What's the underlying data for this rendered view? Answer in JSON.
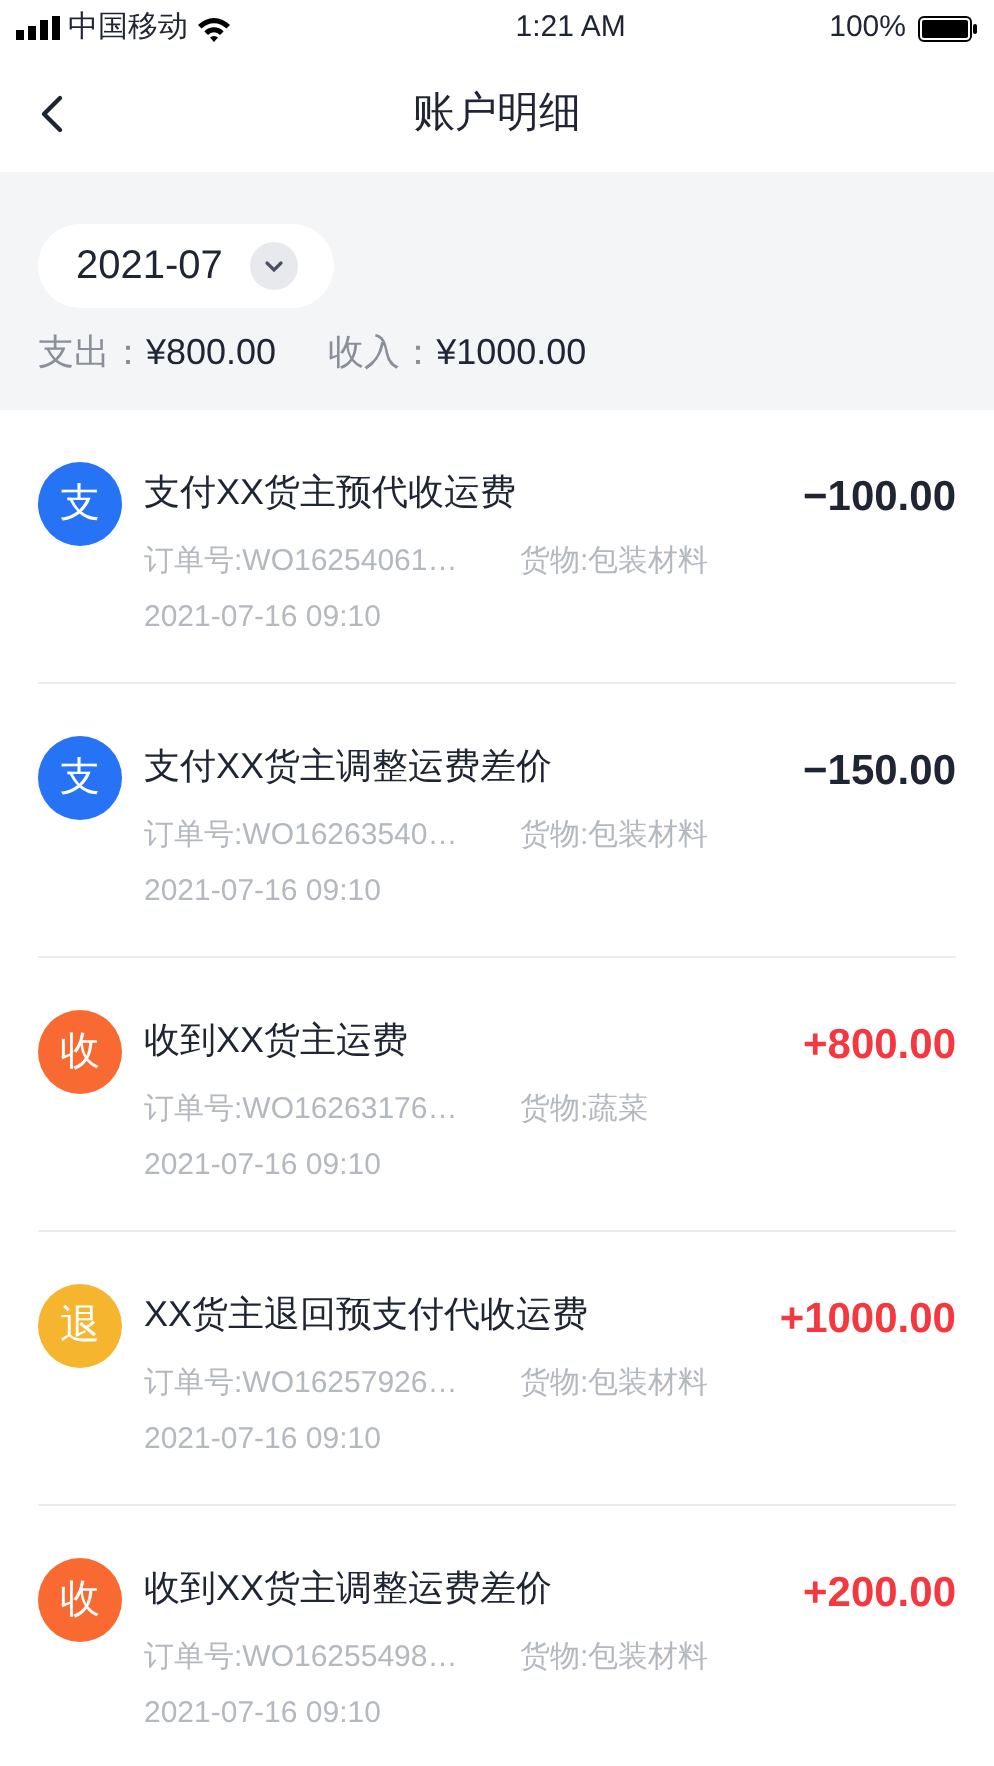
{
  "status_bar": {
    "carrier": "中国移动",
    "time": "1:21 AM",
    "battery": "100%"
  },
  "header": {
    "title": "账户明细"
  },
  "filter": {
    "month": "2021-07"
  },
  "summary": [
    {
      "label": "支出：",
      "value": "¥800.00"
    },
    {
      "label": "收入：",
      "value": "¥1000.00"
    }
  ],
  "transactions": [
    {
      "badge": "支",
      "color": "#2673f5",
      "kind": "expense",
      "title": "支付XX货主预代收运费",
      "amount": "−100.00",
      "order": "订单号:WO16254061…",
      "goods": "货物:包装材料",
      "time": "2021-07-16 09:10"
    },
    {
      "badge": "支",
      "color": "#2673f5",
      "kind": "expense",
      "title": "支付XX货主调整运费差价",
      "amount": "−150.00",
      "order": "订单号:WO16263540…",
      "goods": "货物:包装材料",
      "time": "2021-07-16 09:10"
    },
    {
      "badge": "收",
      "color": "#f86a32",
      "kind": "income",
      "title": "收到XX货主运费",
      "amount": "+800.00",
      "order": "订单号:WO16263176…",
      "goods": "货物:蔬菜",
      "time": "2021-07-16 09:10"
    },
    {
      "badge": "退",
      "color": "#f6b52e",
      "kind": "income",
      "title": "XX货主退回预支付代收运费",
      "amount": "+1000.00",
      "order": "订单号:WO16257926…",
      "goods": "货物:包装材料",
      "time": "2021-07-16 09:10"
    },
    {
      "badge": "收",
      "color": "#f86a32",
      "kind": "income",
      "title": "收到XX货主调整运费差价",
      "amount": "+200.00",
      "order": "订单号:WO16255498…",
      "goods": "货物:包装材料",
      "time": "2021-07-16 09:10"
    }
  ]
}
